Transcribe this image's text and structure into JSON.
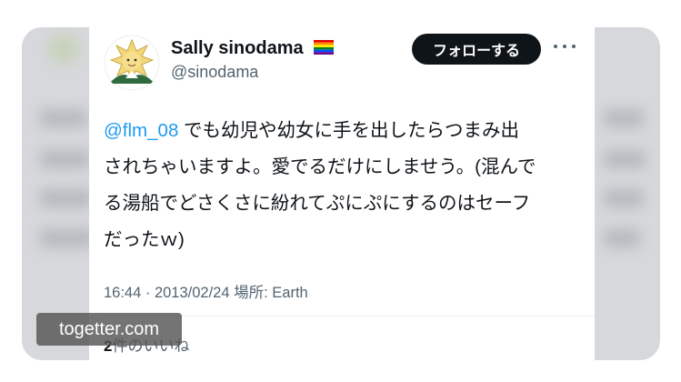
{
  "tweet": {
    "author_name": "Sally sinodama",
    "author_handle": "@sinodama",
    "follow_label": "フォローする",
    "mention": "@flm_08",
    "lines": [
      " でも幼児や幼女に手を出したらつまみ出",
      "されちゃいますよ。愛でるだけにしませう。(混んで",
      "る湯船でどさくさに紛れてぷにぷにするのはセーフ",
      "だったｗ)"
    ],
    "timestamp": "16:44 · 2013/02/24 場所: Earth",
    "likes_count": "2",
    "likes_label": "件のいいね"
  },
  "watermark": "togetter.com",
  "icons": [
    "rainbow-flag-icon",
    "more-options-icon",
    "mascot-avatar"
  ],
  "colors": {
    "text": "#0f1419",
    "secondary": "#536471",
    "link": "#1d9bf0",
    "button_bg": "#0f1419",
    "button_text": "#ffffff"
  }
}
